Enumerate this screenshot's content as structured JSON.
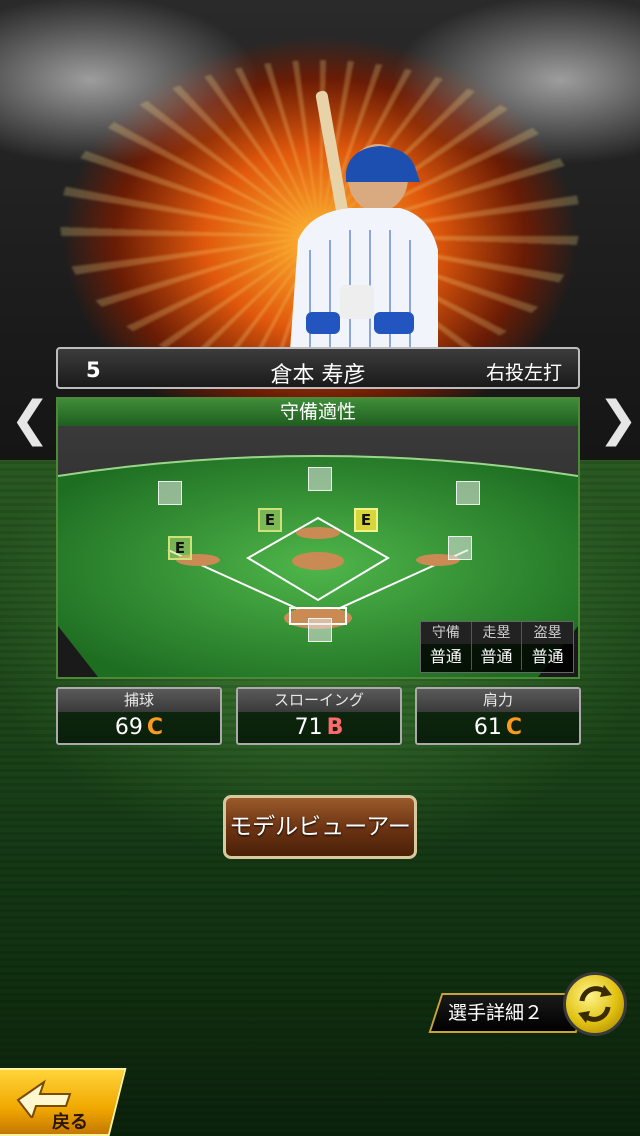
{
  "player": {
    "number": "5",
    "name": "倉本 寿彦",
    "handedness": "右投左打"
  },
  "nav": {
    "prev_icon": "chevron-left-icon",
    "next_icon": "chevron-right-icon"
  },
  "defense": {
    "title": "守備適性",
    "positions": {
      "second_base": "E",
      "shortstop": "E",
      "third_base": "E"
    },
    "summary": {
      "headers": [
        "守備",
        "走塁",
        "盗塁"
      ],
      "values": [
        "普通",
        "普通",
        "普通"
      ]
    }
  },
  "stats": [
    {
      "label": "捕球",
      "value": "69",
      "grade": "C"
    },
    {
      "label": "スローイング",
      "value": "71",
      "grade": "B"
    },
    {
      "label": "肩力",
      "value": "61",
      "grade": "C"
    }
  ],
  "buttons": {
    "model_viewer": "モデルビューアー",
    "player_detail": "選手詳細２",
    "back": "戻る"
  },
  "colors": {
    "grade_c": "#ff9a1e",
    "grade_b": "#ff6b6b",
    "panel_green": "#3f8c3a",
    "button_gold": "#f0a800"
  }
}
